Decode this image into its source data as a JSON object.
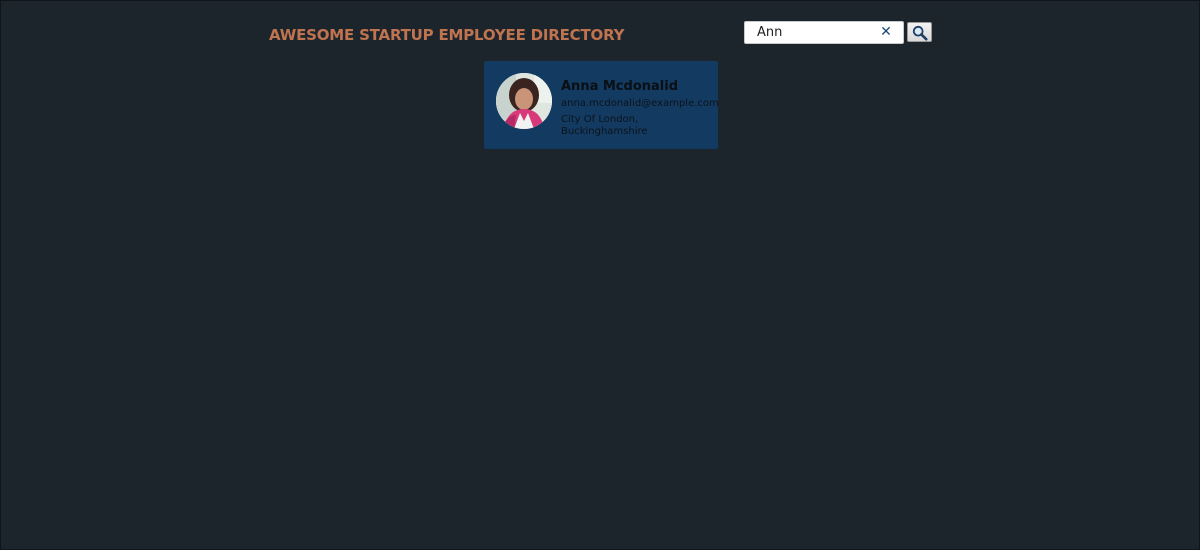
{
  "header": {
    "title": "AWESOME STARTUP EMPLOYEE DIRECTORY"
  },
  "search": {
    "value": "Ann",
    "clear_icon": "close-icon",
    "button_icon": "magnifier-icon"
  },
  "employees": [
    {
      "name": "Anna Mcdonalid",
      "email": "anna.mcdonalid@example.com",
      "location": "City Of London, Buckinghamshire",
      "avatar": "employee-photo"
    }
  ],
  "colors": {
    "background": "#1d252c",
    "title": "#c0734f",
    "card": "#133a61",
    "clear_icon": "#1f4a78"
  }
}
